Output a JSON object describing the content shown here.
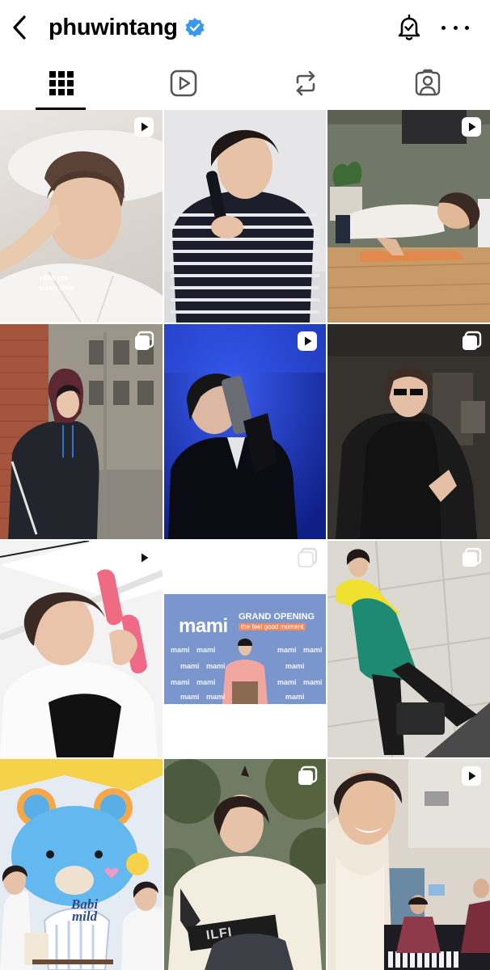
{
  "header": {
    "username": "phuwintang",
    "verified_icon": "verified-badge-icon",
    "back_icon": "chevron-left-icon",
    "notifications_icon": "bell-check-icon",
    "more_icon": "more-horizontal-icon"
  },
  "tabs": [
    {
      "name": "posts",
      "icon": "grid-icon",
      "active": true
    },
    {
      "name": "reels",
      "icon": "reels-icon",
      "active": false
    },
    {
      "name": "reposts",
      "icon": "repost-icon",
      "active": false
    },
    {
      "name": "tagged",
      "icon": "tagged-person-icon",
      "active": false
    }
  ],
  "posts": [
    {
      "id": 1,
      "badge": "reel",
      "caption_line1": "+888 pts",
      "caption_line2": "sleep time"
    },
    {
      "id": 2,
      "badge": "none"
    },
    {
      "id": 3,
      "badge": "reel"
    },
    {
      "id": 4,
      "badge": "carousel"
    },
    {
      "id": 5,
      "badge": "reel"
    },
    {
      "id": 6,
      "badge": "carousel"
    },
    {
      "id": 7,
      "badge": "reel"
    },
    {
      "id": 8,
      "badge": "carousel",
      "banner_title": "mami",
      "banner_sub": "GRAND OPENING",
      "banner_tag": "the feel good moment",
      "backdrop_word": "mami"
    },
    {
      "id": 9,
      "badge": "carousel"
    },
    {
      "id": 10,
      "badge": "none",
      "product_text_1": "Babi",
      "product_text_2": "mild"
    },
    {
      "id": 11,
      "badge": "carousel",
      "shirt_text": "ILFI"
    },
    {
      "id": 12,
      "badge": "reel"
    }
  ],
  "colors": {
    "verified": "#3897f0",
    "tab_active": "#000000",
    "tab_inactive": "#555555"
  }
}
